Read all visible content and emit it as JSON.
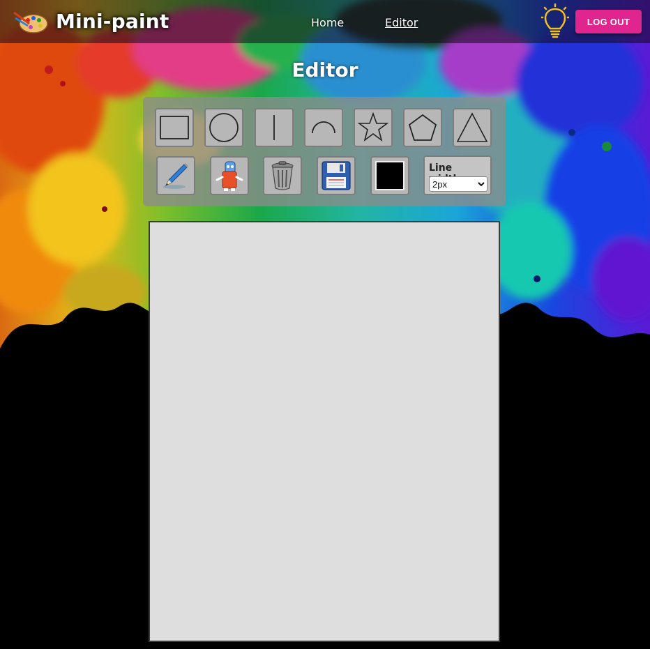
{
  "app": {
    "name": "Mini-paint",
    "logo_icon": "palette-icon"
  },
  "nav": {
    "home_label": "Home",
    "editor_label": "Editor",
    "active": "Editor"
  },
  "header": {
    "theme_icon": "lightbulb-icon",
    "logout_label": "LOG OUT",
    "logout_color": "#e0258f"
  },
  "page": {
    "title": "Editor"
  },
  "toolbar": {
    "shape_tools": [
      {
        "name": "rectangle-icon"
      },
      {
        "name": "circle-icon"
      },
      {
        "name": "line-icon"
      },
      {
        "name": "arc-icon"
      },
      {
        "name": "star-icon"
      },
      {
        "name": "pentagon-icon"
      },
      {
        "name": "triangle-icon"
      }
    ],
    "action_tools": [
      {
        "name": "pencil-icon"
      },
      {
        "name": "eraser-icon"
      },
      {
        "name": "trash-icon"
      },
      {
        "name": "floppy-disk-icon"
      }
    ],
    "color_value": "#000000",
    "line_width": {
      "label": "Line width:",
      "selected": "2px"
    }
  },
  "canvas": {
    "background": "#dedede"
  }
}
